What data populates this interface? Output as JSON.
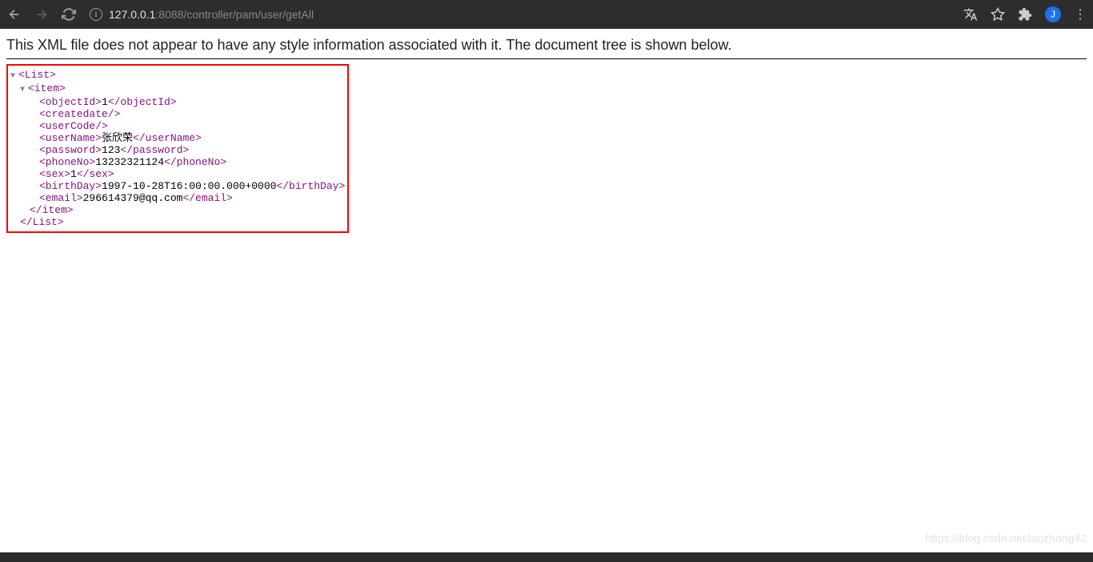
{
  "url": {
    "host": "127.0.0.1",
    "port": ":8088",
    "path": "/controller/pam/user/getAll"
  },
  "avatar_letter": "J",
  "notice": "This XML file does not appear to have any style information associated with it. The document tree is shown below.",
  "xml": {
    "root_open": "<List>",
    "root_close": "</List>",
    "item_open": "<item>",
    "item_close": "</item>",
    "objectId_open": "<objectId>",
    "objectId_val": "1",
    "objectId_close": "</objectId>",
    "createdate": "<createdate/>",
    "userCode": "<userCode/>",
    "userName_open": "<userName>",
    "userName_val": "张欣荣",
    "userName_close": "</userName>",
    "password_open": "<password>",
    "password_val": "123",
    "password_close": "</password>",
    "phoneNo_open": "<phoneNo>",
    "phoneNo_val": "13232321124",
    "phoneNo_close": "</phoneNo>",
    "sex_open": "<sex>",
    "sex_val": "1",
    "sex_close": "</sex>",
    "birthDay_open": "<birthDay>",
    "birthDay_val": "1997-10-28T16:00:00.000+0000",
    "birthDay_close": "</birthDay>",
    "email_open": "<email>",
    "email_val": "296614379@qq.com",
    "email_close": "</email>"
  },
  "watermark": "https://blog.csdn.net/laozhang42"
}
